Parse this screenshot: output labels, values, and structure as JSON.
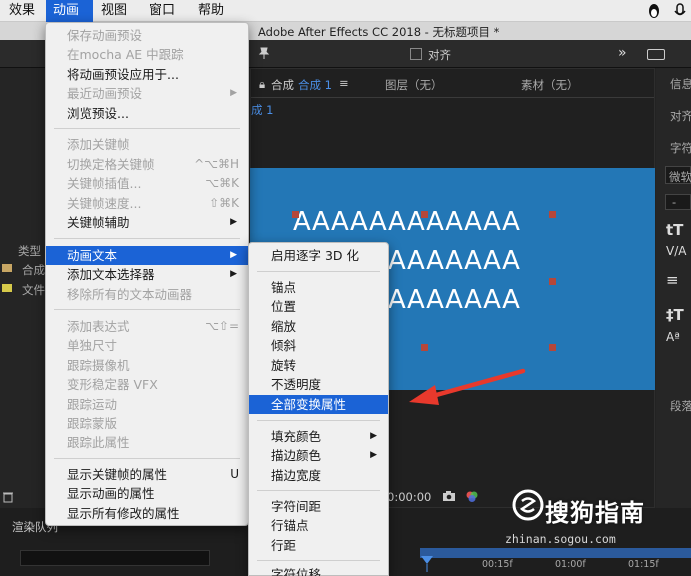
{
  "menubar": {
    "items": [
      "效果",
      "动画",
      "视图",
      "窗口",
      "帮助"
    ],
    "active_index": 1
  },
  "app": {
    "title": "Adobe After Effects CC 2018 - 无标题项目 *"
  },
  "toolbar": {
    "align_label": "对齐"
  },
  "comp_panel": {
    "tab_prefix": "合成",
    "tab_comp_name": "合成 1",
    "layer_label": "图层（无）",
    "footage_label": "素材（无）",
    "breadcrumb": "成 1",
    "timecode": "0:00:00",
    "text_lines": [
      "AAAAAAAAAAAA",
      "AAAAAAAAAAAA",
      "AAAAAAAAAAAA",
      "AA"
    ]
  },
  "left_panel": {
    "type_label": "类型",
    "item1": "合成",
    "item2": "文件"
  },
  "right_panel": {
    "info": "信息",
    "align": "对齐",
    "char": "字符",
    "font": "微软",
    "dash": "-",
    "para": "段落"
  },
  "timeline": {
    "render_queue": "渲染队列",
    "ticks": [
      "00:15f",
      "01:00f",
      "01:15f"
    ]
  },
  "main_menu": {
    "items": [
      {
        "label": "保存动画预设",
        "enabled": false
      },
      {
        "label": "在mocha AE 中跟踪",
        "enabled": false
      },
      {
        "label": "将动画预设应用于...",
        "enabled": true
      },
      {
        "label": "最近动画预设",
        "enabled": false,
        "submenu": true
      },
      {
        "label": "浏览预设...",
        "enabled": true
      },
      {
        "label": "添加关键帧",
        "enabled": false
      },
      {
        "label": "切换定格关键帧",
        "enabled": false,
        "shortcut": "^⌥⌘H"
      },
      {
        "label": "关键帧插值...",
        "enabled": false,
        "shortcut": "⌥⌘K"
      },
      {
        "label": "关键帧速度...",
        "enabled": false,
        "shortcut": "⇧⌘K"
      },
      {
        "label": "关键帧辅助",
        "enabled": true,
        "submenu": true
      },
      {
        "label": "动画文本",
        "enabled": true,
        "submenu": true,
        "highlighted": true
      },
      {
        "label": "添加文本选择器",
        "enabled": true,
        "submenu": true
      },
      {
        "label": "移除所有的文本动画器",
        "enabled": false
      },
      {
        "label": "添加表达式",
        "enabled": false,
        "shortcut": "⌥⇧="
      },
      {
        "label": "单独尺寸",
        "enabled": false
      },
      {
        "label": "跟踪摄像机",
        "enabled": false
      },
      {
        "label": "变形稳定器 VFX",
        "enabled": false
      },
      {
        "label": "跟踪运动",
        "enabled": false
      },
      {
        "label": "跟踪蒙版",
        "enabled": false
      },
      {
        "label": "跟踪此属性",
        "enabled": false
      },
      {
        "label": "显示关键帧的属性",
        "enabled": true,
        "shortcut": "U"
      },
      {
        "label": "显示动画的属性",
        "enabled": true
      },
      {
        "label": "显示所有修改的属性",
        "enabled": true
      }
    ]
  },
  "sub_menu": {
    "items": [
      {
        "label": "启用逐字 3D 化"
      },
      {
        "label": "锚点"
      },
      {
        "label": "位置"
      },
      {
        "label": "缩放"
      },
      {
        "label": "倾斜"
      },
      {
        "label": "旋转"
      },
      {
        "label": "不透明度"
      },
      {
        "label": "全部变换属性",
        "highlighted": true
      },
      {
        "label": "填充颜色",
        "submenu": true
      },
      {
        "label": "描边颜色",
        "submenu": true
      },
      {
        "label": "描边宽度"
      },
      {
        "label": "字符间距"
      },
      {
        "label": "行锚点"
      },
      {
        "label": "行距"
      },
      {
        "label": "字符位移"
      }
    ]
  },
  "watermark": {
    "text": "搜狗指南",
    "url": "zhinan.sogou.com"
  },
  "colors": {
    "menu_highlight": "#1b63d6",
    "canvas": "#2377b6",
    "arrow": "#e8392c"
  }
}
